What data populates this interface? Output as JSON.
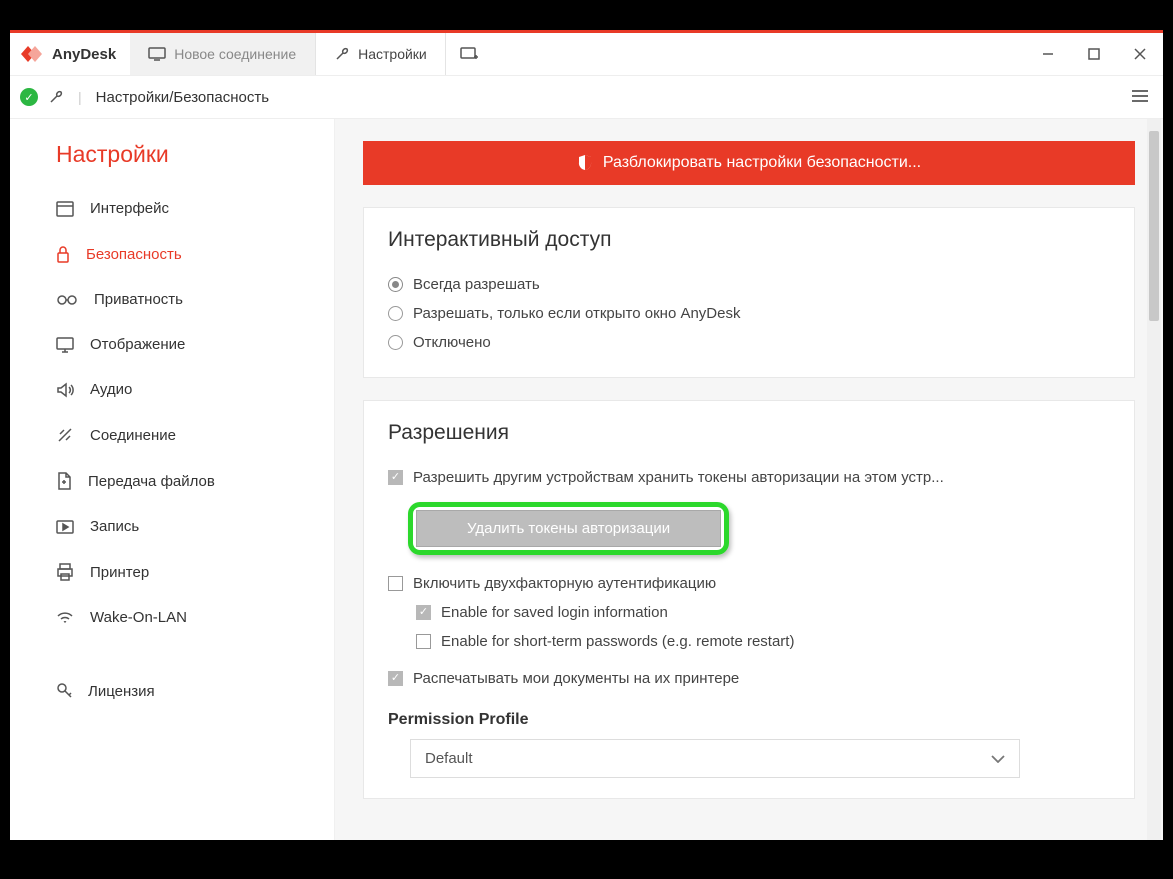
{
  "app": {
    "name": "AnyDesk"
  },
  "tabs": {
    "new_connection": "Новое соединение",
    "settings": "Настройки"
  },
  "breadcrumb": "Настройки/Безопасность",
  "sidebar": {
    "title": "Настройки",
    "items": [
      {
        "label": "Интерфейс"
      },
      {
        "label": "Безопасность"
      },
      {
        "label": "Приватность"
      },
      {
        "label": "Отображение"
      },
      {
        "label": "Аудио"
      },
      {
        "label": "Соединение"
      },
      {
        "label": "Передача файлов"
      },
      {
        "label": "Запись"
      },
      {
        "label": "Принтер"
      },
      {
        "label": "Wake-On-LAN"
      },
      {
        "label": "Лицензия"
      }
    ]
  },
  "unlock": "Разблокировать настройки безопасности...",
  "section_access": {
    "title": "Интерактивный доступ",
    "opt1": "Всегда разрешать",
    "opt2": "Разрешать, только если открыто окно AnyDesk",
    "opt3": "Отключено"
  },
  "section_perm": {
    "title": "Разрешения",
    "c1": "Разрешить другим устройствам хранить токены авторизации на этом устр...",
    "del_btn": "Удалить токены авторизации",
    "c2": "Включить двухфакторную аутентификацию",
    "c2a": "Enable for saved login information",
    "c2b": "Enable for short-term passwords (e.g. remote restart)",
    "c3": "Распечатывать мои документы на их принтере",
    "profile_label": "Permission Profile",
    "profile_value": "Default"
  }
}
